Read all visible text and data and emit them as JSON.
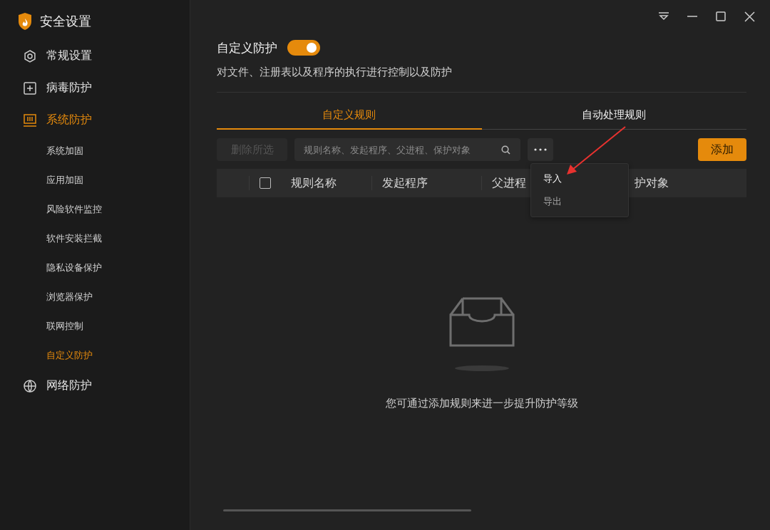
{
  "window": {
    "title": "安全设置"
  },
  "nav": [
    {
      "label": "常规设置",
      "selected": false
    },
    {
      "label": "病毒防护",
      "selected": false
    },
    {
      "label": "系统防护",
      "selected": true,
      "children": [
        {
          "label": "系统加固",
          "selected": false
        },
        {
          "label": "应用加固",
          "selected": false
        },
        {
          "label": "风险软件监控",
          "selected": false
        },
        {
          "label": "软件安装拦截",
          "selected": false
        },
        {
          "label": "隐私设备保护",
          "selected": false
        },
        {
          "label": "浏览器保护",
          "selected": false
        },
        {
          "label": "联网控制",
          "selected": false
        },
        {
          "label": "自定义防护",
          "selected": true
        }
      ]
    },
    {
      "label": "网络防护",
      "selected": false
    }
  ],
  "header": {
    "title": "自定义防护",
    "on": true,
    "description": "对文件、注册表以及程序的执行进行控制以及防护"
  },
  "tabs": [
    {
      "label": "自定义规则",
      "selected": true
    },
    {
      "label": "自动处理规则",
      "selected": false
    }
  ],
  "toolbar": {
    "delete_button": {
      "label": "删除所选",
      "disabled": true
    },
    "search": {
      "placeholder": "规则名称、发起程序、父进程、保护对象"
    },
    "add_button": "添加"
  },
  "menu": {
    "items": [
      {
        "label": "导入",
        "selected": true
      },
      {
        "label": "导出",
        "selected": false
      }
    ]
  },
  "table": {
    "select_all_checked": false,
    "columns": [
      "规则名称",
      "发起程序",
      "父进程",
      "护对象"
    ]
  },
  "empty_state": {
    "message": "您可通过添加规则来进一步提升防护等级"
  }
}
